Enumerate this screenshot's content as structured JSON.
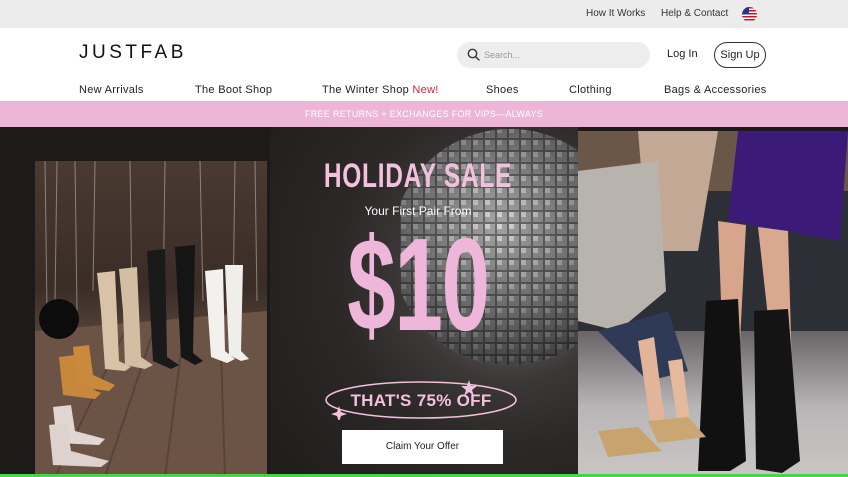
{
  "utility_bar": {
    "how_it_works": "How It Works",
    "help_contact": "Help & Contact",
    "region_icon": "us-flag-icon"
  },
  "header": {
    "logo": "JUSTFAB",
    "search_placeholder": "Search...",
    "login": "Log In",
    "signup": "Sign Up"
  },
  "nav": {
    "items": [
      {
        "label": "New Arrivals"
      },
      {
        "label": "The Boot Shop"
      },
      {
        "label": "The Winter Shop",
        "badge": "New!"
      },
      {
        "label": "Shoes"
      },
      {
        "label": "Clothing"
      },
      {
        "label": "Bags & Accessories"
      }
    ]
  },
  "promo_banner": {
    "text": "FREE RETURNS + EXCHANGES FOR VIPS—ALWAYS"
  },
  "hero": {
    "title": "HOLIDAY SALE",
    "subtitle": "Your First Pair From",
    "price": "$10",
    "discount": "THAT'S 75% OFF",
    "cta": "Claim Your Offer"
  },
  "colors": {
    "accent_pink": "#edb5d6",
    "hero_pink": "#f2c1dd",
    "new_badge_red": "#d3273e",
    "hero_bg": "#1d1a1a"
  }
}
